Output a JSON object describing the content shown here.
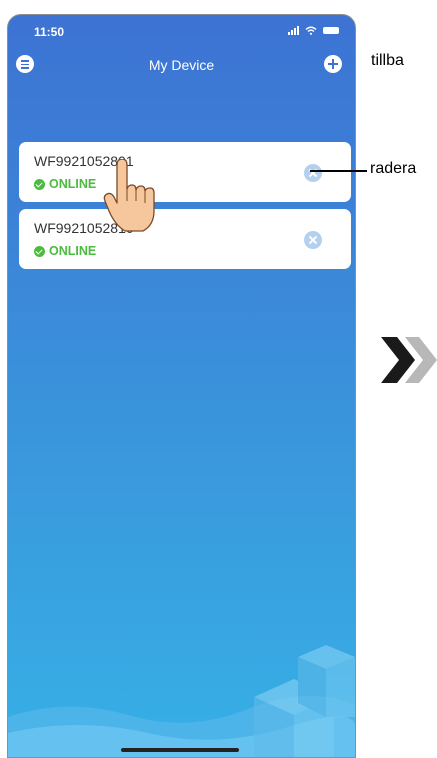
{
  "status_bar": {
    "time": "11:50"
  },
  "nav": {
    "title": "My Device",
    "menu_icon": "menu-icon",
    "add_icon": "plus-icon"
  },
  "devices": [
    {
      "name": "WF9921052801",
      "status": "ONLINE"
    },
    {
      "name": "WF9921052810",
      "status": "ONLINE"
    }
  ],
  "annotations": {
    "back_label": "tillba",
    "delete_label": "radera"
  },
  "colors": {
    "status_online": "#4cbb3f",
    "gradient_top": "#3d73d3",
    "gradient_bottom": "#36b0e6",
    "delete_button": "#b3d0ef"
  }
}
